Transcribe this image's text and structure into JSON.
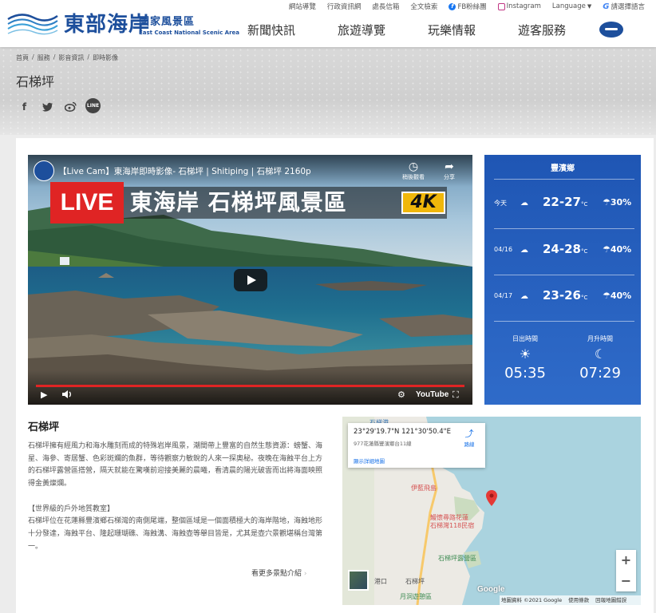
{
  "header": {
    "logo_cn": "東部海岸",
    "logo_cn2": "國家風景區",
    "logo_en": "East Coast National Scenic Area",
    "top_links": [
      "網站導覽",
      "行政資訊網",
      "處長信箱",
      "全文檢索",
      "FB粉絲團",
      "Instagram",
      "Language",
      "請選擇語言"
    ],
    "nav": [
      "新聞快訊",
      "旅遊導覽",
      "玩樂情報",
      "遊客服務"
    ]
  },
  "breadcrumb": [
    "首頁",
    "/",
    "服務",
    "/",
    "影音資訊",
    "/",
    "即時影像"
  ],
  "page_title": "石梯坪",
  "share": {
    "facebook": "f",
    "line": "LINE"
  },
  "video": {
    "title": "【Live Cam】東海岸即時影像- 石梯坪 | Shitiping | 石梯坪 2160p",
    "watch_later": "稍後觀看",
    "share": "分享",
    "live_label": "LIVE",
    "banner_text": "東海岸 石梯坪風景區",
    "quality": "4K",
    "brand": "YouTube"
  },
  "weather": {
    "location": "豐濱鄉",
    "rows": [
      {
        "day": "今天",
        "temp": "22-27",
        "unit": "°C",
        "rain": "30%"
      },
      {
        "day": "04/16",
        "temp": "24-28",
        "unit": "°C",
        "rain": "40%"
      },
      {
        "day": "04/17",
        "temp": "23-26",
        "unit": "°C",
        "rain": "40%"
      }
    ],
    "sunrise_label": "日出時間",
    "sunrise": "05:35",
    "moonrise_label": "月升時間",
    "moonrise": "07:29"
  },
  "section": {
    "title": "石梯坪",
    "para1": "石梯坪擁有經風力和海水雕刻而成的特殊岩岸風景，潮間帶上豐富的自然生態資源：螃蟹、海星、海參、寄居蟹、色彩斑斕的魚群，等待觀察力敏銳的人來一探奧秘。夜晚在海蝕平台上方的石梯坪露營區搭營，隔天就能在驚嘆前迎接美麗的晨曦，看清晨的陽光破雲而出將海面映照得金黃燦爛。",
    "heading2": "【世界級的戶外地質教室】",
    "para2": "石梯坪位在花蓮縣豐濱鄉石梯灣的南側尾端，整個區域是一個面積極大的海岸階地，海蝕地形十分發達，海蝕平台、隆起珊瑚礁、海蝕溝、海蝕壺等舉目皆是，尤其是壺穴景觀堪稱台灣第一。",
    "more": "看更多景點介紹"
  },
  "map": {
    "coord": "23°29'19.7\"N 121°30'50.4\"E",
    "address": "977花蓮縣豐濱鄉台11線",
    "route": "路線",
    "bigger": "顯示詳細地圖",
    "labels": [
      "石梯港",
      "伊藍飛島",
      "鰻懷尋路花蓮",
      "石梯灣118民宿",
      "石梯坪露營區",
      "石梯坪",
      "港口",
      "月洞遊憩區"
    ],
    "zoom_in": "+",
    "zoom_out": "−",
    "google": "Google",
    "footer": [
      "地圖資料 ©2021 Google",
      "使用條款",
      "回報地圖錯誤"
    ]
  }
}
